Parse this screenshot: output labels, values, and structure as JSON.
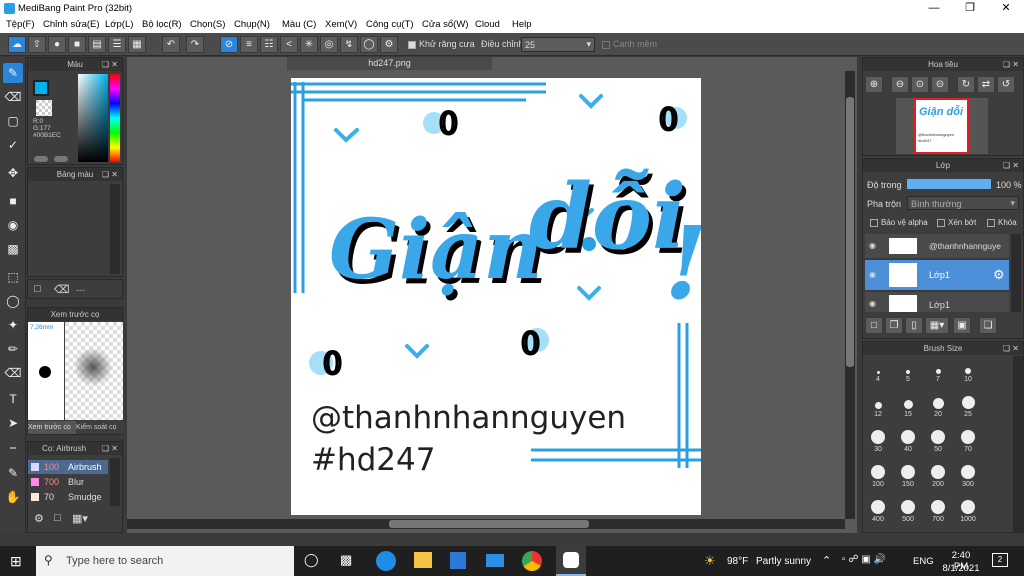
{
  "window": {
    "title": "MediBang Paint Pro (32bit)"
  },
  "menu": [
    "Tệp(F)",
    "Chỉnh sửa(E)",
    "Lớp(L)",
    "Bộ lọc(R)",
    "Chọn(S)",
    "Chụp(N)",
    "Màu (C)",
    "Xem(V)",
    "Công cụ(T)",
    "Cửa sổ(W)",
    "Cloud",
    "Help"
  ],
  "toolbar": {
    "antialias_label": "Khử răng cưa",
    "adjust_label": "Điều chỉnh",
    "adjust_value": "25",
    "edge_label": "Canh mềm"
  },
  "color_panel": {
    "title": "Màu",
    "r": "R:0",
    "g": "G:177",
    "hex": "#00B1EC",
    "accent": "#00B1EC"
  },
  "palette_panel": {
    "title": "Bảng màu",
    "dash": "---"
  },
  "preview_panel": {
    "title": "Xem trước cọ",
    "size": "7.26mm",
    "tab1": "Xem trước cọ",
    "tab2": "Kiểm soát cọ"
  },
  "brush_panel": {
    "title": "Cọ: Airbrush",
    "items": [
      {
        "size": "100",
        "name": "Airbrush",
        "color": "#d8d8ff"
      },
      {
        "size": "700",
        "name": "Blur",
        "color": "#ff88ee"
      },
      {
        "size": "70",
        "name": "Smudge",
        "color": "#ffe8d8"
      }
    ]
  },
  "document": {
    "tab": "hd247.png",
    "handle": "@thanhnhannguyen",
    "tag": "#hd247",
    "headline_a": "Giận",
    "headline_b": "dỗi",
    "exclaim": "!"
  },
  "navigator": {
    "title": "Hoa tiêu",
    "thumb_text": "Giận dỗi",
    "thumb_handle": "@thanhnhannguyen",
    "thumb_tag": "#hd247"
  },
  "layer_panel": {
    "title": "Lớp",
    "opacity_label": "Độ trong",
    "opacity_value": "100 %",
    "opacity_fraction": 1.0,
    "blend_label": "Pha trộn",
    "blend_value": "Bình thường",
    "protect_alpha": "Bảo vệ alpha",
    "clipping": "Xén bớt",
    "lock": "Khóa",
    "layers": [
      {
        "name": "@thanhnhannguye"
      },
      {
        "name": "Lớp1"
      },
      {
        "name": "Lớp1"
      }
    ]
  },
  "brush_size": {
    "title": "Brush Size",
    "sizes": [
      "4",
      "5",
      "7",
      "10",
      "12",
      "15",
      "20",
      "25",
      "30",
      "40",
      "50",
      "70",
      "100",
      "150",
      "200",
      "300",
      "400",
      "500",
      "700",
      "1000"
    ]
  },
  "taskbar": {
    "search_placeholder": "Type here to search",
    "weather_temp": "98°F",
    "weather_desc": "Partly sunny",
    "lang": "ENG",
    "time": "2:40 PM",
    "date": "8/1/2021",
    "notif": "2"
  }
}
